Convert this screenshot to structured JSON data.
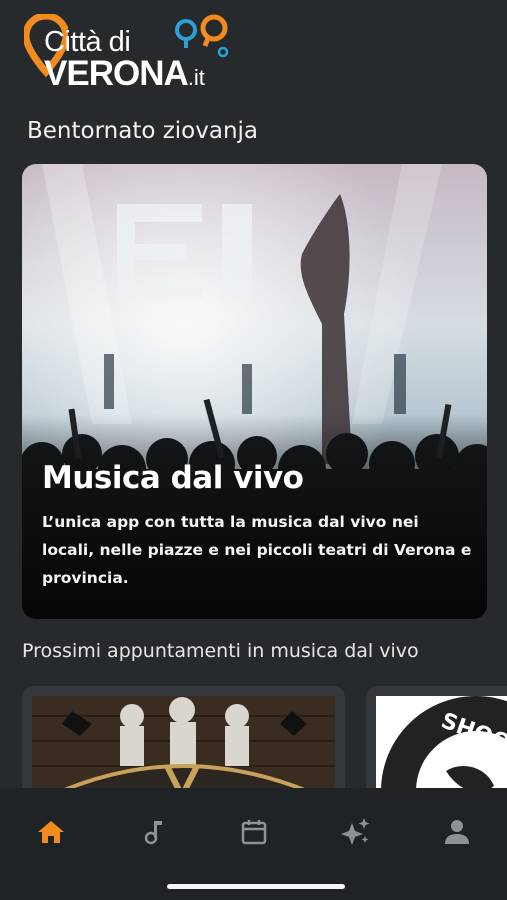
{
  "app": {
    "logo_line1": "Città di",
    "logo_line2": "VERONA",
    "logo_tld": ".it",
    "accent": "#f28c1e",
    "bubble_color": "#2a9fd8"
  },
  "greeting": "Bentornato ziovanja",
  "hero": {
    "title": "Musica dal vivo",
    "description": "L’unica app con tutta la musica dal vivo nei locali, nelle piazze e nei piccoli teatri di Verona e provincia.",
    "image": "concert-crowd-image"
  },
  "section_title": "Prossimi appuntamenti in musica dal vivo",
  "events": [
    {
      "image": "band-poster-image"
    },
    {
      "image": "shoot-logo-image",
      "visible_text": "SHOOT"
    }
  ],
  "bottom_nav": {
    "items": [
      {
        "icon": "home-icon",
        "active": true
      },
      {
        "icon": "music-note-icon",
        "active": false
      },
      {
        "icon": "calendar-icon",
        "active": false
      },
      {
        "icon": "sparkles-icon",
        "active": false
      },
      {
        "icon": "user-icon",
        "active": false
      }
    ],
    "active_color": "#f28c1e",
    "inactive_color": "#8d9296"
  }
}
